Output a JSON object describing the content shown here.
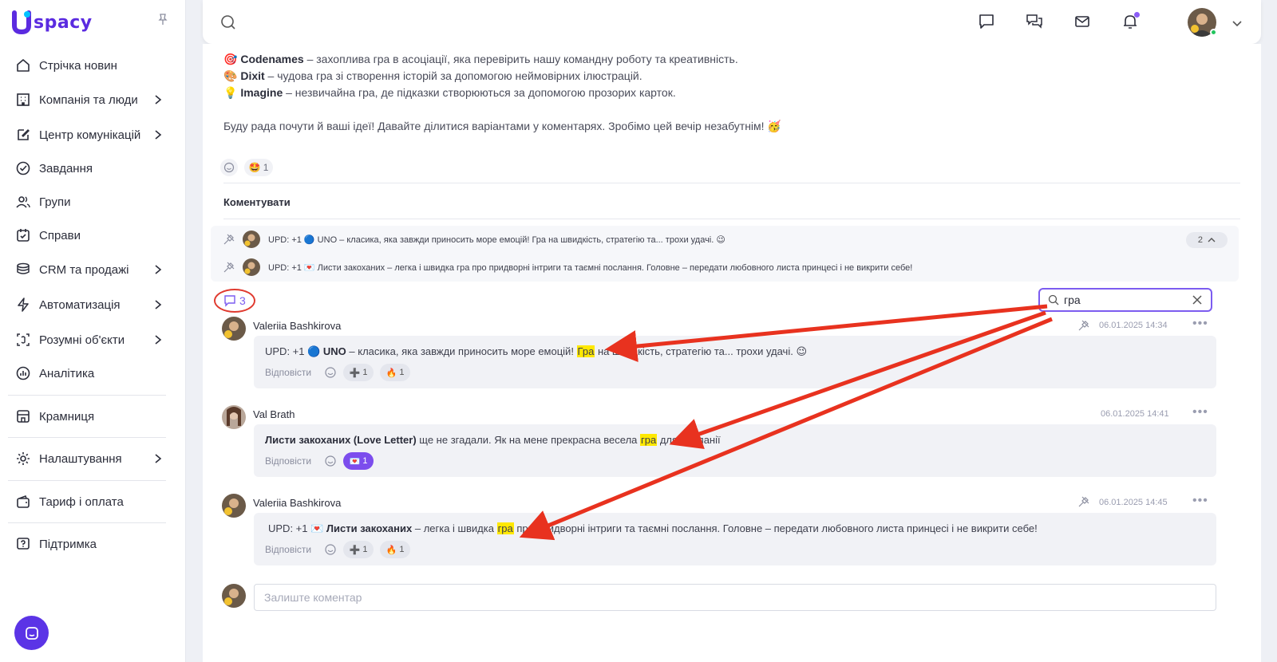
{
  "brand": {
    "name": "spacy",
    "logo_letter": "U"
  },
  "sidebar": {
    "items": [
      {
        "label": "Стрічка новин",
        "icon": "home-icon",
        "has_submenu": false
      },
      {
        "label": "Компанія та люди",
        "icon": "building-icon",
        "has_submenu": true
      },
      {
        "label": "Центр комунікацій",
        "icon": "edit-icon",
        "has_submenu": true
      },
      {
        "label": "Завдання",
        "icon": "check-circle-icon",
        "has_submenu": false
      },
      {
        "label": "Групи",
        "icon": "users-icon",
        "has_submenu": false
      },
      {
        "label": "Справи",
        "icon": "calendar-check-icon",
        "has_submenu": false
      },
      {
        "label": "CRM та продажі",
        "icon": "coins-icon",
        "has_submenu": true
      },
      {
        "label": "Автоматизація",
        "icon": "lightning-icon",
        "has_submenu": true
      },
      {
        "label": "Розумні об'єкти",
        "icon": "smart-object-icon",
        "has_submenu": true
      },
      {
        "label": "Аналітика",
        "icon": "chart-icon",
        "has_submenu": false
      },
      {
        "label": "Крамниця",
        "icon": "store-icon",
        "has_submenu": false
      },
      {
        "label": "Налаштування",
        "icon": "gear-icon",
        "has_submenu": true
      },
      {
        "label": "Тариф і оплата",
        "icon": "wallet-icon",
        "has_submenu": false
      },
      {
        "label": "Підтримка",
        "icon": "help-icon",
        "has_submenu": false
      }
    ]
  },
  "post": {
    "lines": [
      {
        "emoji": "🎯",
        "title": "Codenames",
        "text": " – захоплива гра в асоціації, яка перевірить нашу командну роботу та креативність."
      },
      {
        "emoji": "🎨",
        "title": "Dixit",
        "text": " – чудова гра зі створення історій за допомогою неймовірних ілюстрацій."
      },
      {
        "emoji": "💡",
        "title": "Imagine",
        "text": " – незвичайна гра, де підказки створюються за допомогою прозорих карток."
      }
    ],
    "closing": "Буду рада почути й ваші ідеї! Давайте ділитися варіантами у коментарях. Зробімо цей вечір незабутнім! 🥳",
    "reaction": {
      "emoji": "🤩",
      "count": "1"
    }
  },
  "comments_section": {
    "title": "Коментувати",
    "pinned": [
      {
        "text": "UPD: +1 🔵 UNO – класика, яка завжди приносить море емоцій! Гра на швидкість, стратегію та... трохи удачі. 😉"
      },
      {
        "text": "UPD: +1 💌 Листи закоханих – легка і швидка гра про придворні інтриги та таємні послання. Головне – передати любовного листа принцесі і не викрити себе!"
      }
    ],
    "pinned_count": "2",
    "comment_count": "3",
    "search_value": "гра",
    "reply_label": "Відповісти",
    "compose_placeholder": "Залиште коментар",
    "comments": [
      {
        "author": "Valeriia Bashkirova",
        "date": "06.01.2025 14:34",
        "prefix": "UPD: +1 🔵 ",
        "bold": "UNO",
        "before": "  – класика, яка завжди приносить море емоцій! ",
        "match": "Гра",
        "after": " на швидкість, стратегію та... трохи удачі. 😉",
        "reactions": [
          {
            "emoji": "➕",
            "count": "1"
          },
          {
            "emoji": "🔥",
            "count": "1"
          }
        ]
      },
      {
        "author": "Val Brath",
        "date": "06.01.2025 14:41",
        "prefix": "",
        "bold": "Листи закоханих (Love Letter)",
        "before": " ще не згадали. Як на мене прекрасна весела ",
        "match": "гра",
        "after": " для компанії",
        "reactions": [
          {
            "emoji": "💌",
            "count": "1"
          }
        ]
      },
      {
        "author": "Valeriia Bashkirova",
        "date": "06.01.2025 14:45",
        "prefix": "UPD: +1 💌 ",
        "bold": "Листи закоханих",
        "before": " – легка і швидка ",
        "match": "гра",
        "after": " про придворні інтриги та таємні послання. Головне – передати любовного листа принцесі і не викрити себе!",
        "reactions": [
          {
            "emoji": "➕",
            "count": "1"
          },
          {
            "emoji": "🔥",
            "count": "1"
          }
        ]
      }
    ]
  },
  "colors": {
    "brand": "#5b2be0",
    "accent": "#7c5cf0",
    "highlight": "#ffe800",
    "annotation": "#e03a2f"
  }
}
